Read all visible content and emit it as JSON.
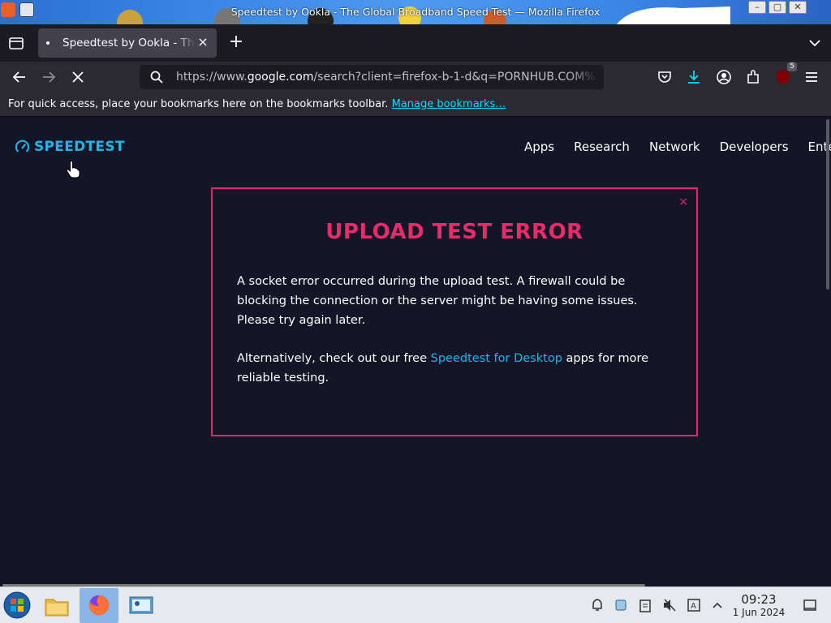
{
  "window": {
    "title": "Speedtest by Ookla - The Global Broadband Speed Test — Mozilla Firefox"
  },
  "browser": {
    "tab_title": "Speedtest by Ookla - The Global Broadband Speed Test",
    "url_prefix": "https://www.",
    "url_domain": "google.com",
    "url_rest": "/search?client=firefox-b-1-d&q=PORNHUB.COM%",
    "extension_badge": "5",
    "bookmarks_message": "For quick access, place your bookmarks here on the bookmarks toolbar.",
    "bookmarks_link": "Manage bookmarks…"
  },
  "site": {
    "logo_text": "SPEEDTEST",
    "nav": [
      "Apps",
      "Research",
      "Network",
      "Developers",
      "Ente"
    ]
  },
  "modal": {
    "close": "×",
    "title": "UPLOAD TEST ERROR",
    "paragraph1": "A socket error occurred during the upload test. A firewall could be blocking the connection or the server might be having some issues. Please try again later.",
    "paragraph2_before": "Alternatively, check out our free ",
    "paragraph2_link": "Speedtest for Desktop",
    "paragraph2_after": " apps for more reliable testing."
  },
  "taskbar": {
    "time": "09:23",
    "date": "1 Jun 2024"
  },
  "colors": {
    "page_bg": "#141526",
    "accent_pink": "#e6266e",
    "accent_cyan": "#1fb5e8",
    "firefox_chrome": "#2b2a33"
  },
  "icons": [
    "tab-list-icon",
    "back-icon",
    "forward-icon",
    "stop-icon",
    "search-icon",
    "pocket-icon",
    "download-icon",
    "account-icon",
    "extensions-icon",
    "ublock-icon",
    "menu-icon",
    "speedtest-gauge-icon",
    "hand-cursor-icon",
    "start-orb-icon",
    "file-manager-icon",
    "firefox-icon",
    "system-settings-icon",
    "notifications-icon",
    "clipboard-icon",
    "tasks-icon",
    "volume-muted-icon",
    "keyboard-layout-icon",
    "tray-expand-icon",
    "show-desktop-icon"
  ]
}
